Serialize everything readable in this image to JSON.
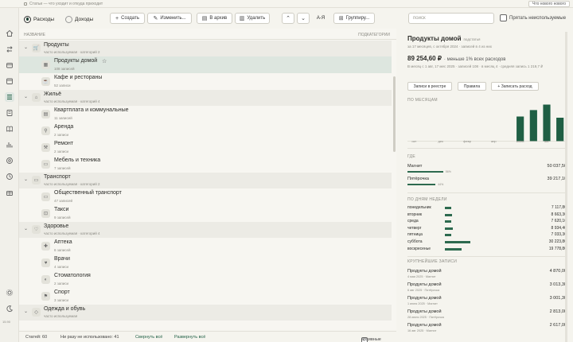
{
  "topbar": {
    "crumb": "Статьи — что уходит и откуда приходит",
    "whats_new": "Что нового нового"
  },
  "rail": {
    "items": [
      "home",
      "transfers",
      "wallet",
      "calendar",
      "categories",
      "list",
      "book",
      "reports",
      "bank",
      "targets",
      "recurring",
      "gift"
    ],
    "active_index": 5,
    "bottom": [
      "settings",
      "theme"
    ],
    "version": "15.90"
  },
  "toolbar": {
    "expenses": "Расходы",
    "income": "Доходы",
    "create": "Создать",
    "edit": "Изменить...",
    "archive": "В архив",
    "delete": "Удалить",
    "sort": "А-Я",
    "group": "Группиру...",
    "search_placeholder": "поиск",
    "hide_empty": "Прятать неиспользуемые"
  },
  "list": {
    "col_title": "НАЗВАНИЕ",
    "col_right": "ПОДКАТЕГОРИИ",
    "groups": [
      {
        "name": "Продукты",
        "sub": "часто используемая · категорий 2",
        "items": [
          {
            "name": "Продукты домой",
            "sub": "108 записей",
            "selected": true
          },
          {
            "name": "Кафе и рестораны",
            "sub": "52 записи"
          }
        ]
      },
      {
        "name": "Жильё",
        "sub": "часто используемая · категорий 4",
        "items": [
          {
            "name": "Квартплата и коммунальные",
            "sub": "11 записей"
          },
          {
            "name": "Аренда",
            "sub": "2 записи"
          },
          {
            "name": "Ремонт",
            "sub": "2 записи"
          },
          {
            "name": "Мебель и техника",
            "sub": "7 записей"
          }
        ]
      },
      {
        "name": "Транспорт",
        "sub": "часто используемая · категорий 2",
        "items": [
          {
            "name": "Общественный транспорт",
            "sub": "47 записей"
          },
          {
            "name": "Такси",
            "sub": "9 записей"
          }
        ]
      },
      {
        "name": "Здоровье",
        "sub": "часто используемая · категорий 4",
        "items": [
          {
            "name": "Аптека",
            "sub": "6 записей"
          },
          {
            "name": "Врачи",
            "sub": "4 записи"
          },
          {
            "name": "Стоматология",
            "sub": "2 записи"
          },
          {
            "name": "Спорт",
            "sub": "3 записи"
          }
        ]
      },
      {
        "name": "Одежда и обувь",
        "sub": "часто используемая",
        "items": []
      }
    ]
  },
  "status": {
    "total": "Статей: 60",
    "unused": "Ни разу не использовано: 41",
    "expand": "Свернуть всё",
    "collapse": "Развернуть всё",
    "archive_toggle": "архивные"
  },
  "detail": {
    "title": "Продукты домой",
    "tag": "подстатья",
    "subtitle": "за 17 месяцев, с октября 2024 · записей в 4 из них",
    "amount": "89 254,60 ₽",
    "amount_note": "· меньше 1% всех расходов",
    "meta": "В месяц с 1 авг, 17 мес 2025 · записей 108 · в месяц 4 · средняя запись 1 219,7 ₽",
    "btn_register": "Записи в реестре",
    "btn_rules": "Правила",
    "btn_add": "+ Записать расход",
    "by_month_head": "ПО МЕСЯЦАМ",
    "months": [
      "окт",
      "дек",
      "февр",
      "апр",
      "июнь",
      "авг"
    ],
    "where_head": "ГДЕ",
    "stores": [
      {
        "name": "Магнит",
        "value": "50 037,50",
        "share": 0.56,
        "note": "56%"
      },
      {
        "name": "Пятёрочка",
        "value": "39 217,10",
        "share": 0.44,
        "note": "44%"
      }
    ],
    "weekday_head": "ПО ДНЯМ НЕДЕЛИ",
    "weekdays": [
      {
        "name": "понедельник",
        "value": "7 117,80",
        "share": 0.24
      },
      {
        "name": "вторник",
        "value": "8 663,30",
        "share": 0.29
      },
      {
        "name": "среда",
        "value": "7 620,10",
        "share": 0.26
      },
      {
        "name": "четверг",
        "value": "8 934,40",
        "share": 0.3
      },
      {
        "name": "пятница",
        "value": "7 033,30",
        "share": 0.24
      },
      {
        "name": "суббота",
        "value": "30 223,80",
        "share": 1.0
      },
      {
        "name": "воскресенье",
        "value": "19 778,80",
        "share": 0.65
      }
    ],
    "biggest_head": "КРУПНЕЙШИЕ ЗАПИСИ",
    "biggest": [
      {
        "name": "Продукты домой",
        "sub": "4 мая 2025 · Магнит",
        "value": "4 870,00"
      },
      {
        "name": "Продукты домой",
        "sub": "6 авг 2025 · Пятёрочка",
        "value": "3 013,30"
      },
      {
        "name": "Продукты домой",
        "sub": "1 июня 2025 · Магнит",
        "value": "3 001,30"
      },
      {
        "name": "Продукты домой",
        "sub": "28 июня 2025 · Пятёрочка",
        "value": "2 813,00"
      },
      {
        "name": "Продукты домой",
        "sub": "16 авг 2025 · Магнит",
        "value": "2 617,00"
      }
    ]
  },
  "chart_data": {
    "type": "bar",
    "categories": [
      "окт",
      "ноя",
      "дек",
      "янв",
      "февр",
      "март",
      "апр",
      "май",
      "июнь",
      "июль",
      "авг",
      "сент"
    ],
    "values": [
      0,
      0,
      0,
      0,
      0,
      0,
      0,
      0,
      10500,
      13200,
      15500,
      10000
    ],
    "tick_labels": [
      "окт",
      "дек",
      "февр",
      "апр",
      "июнь",
      "авг"
    ],
    "title": "",
    "xlabel": "",
    "ylabel": "",
    "ylim": [
      0,
      16000
    ],
    "grid": false,
    "colors": {
      "bar": "#1f5f44"
    }
  },
  "colors": {
    "accent": "#1f5f44",
    "selected_row": "#dde6df",
    "group_row": "#ecebe5"
  }
}
